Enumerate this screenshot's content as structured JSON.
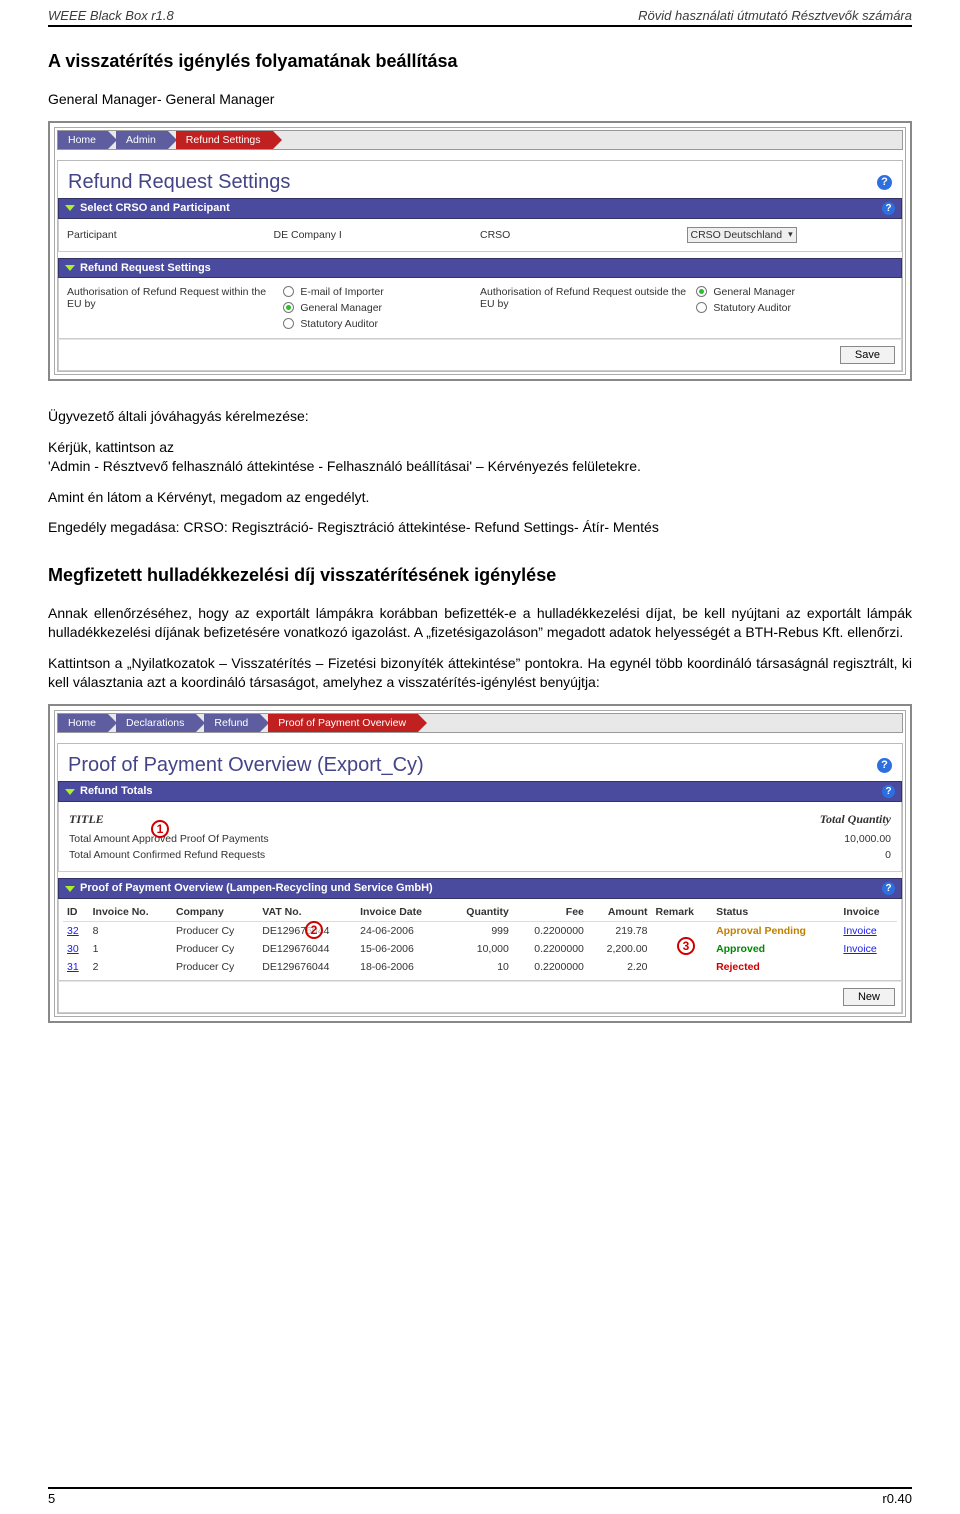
{
  "doc": {
    "header_left": "WEEE Black Box r1.8",
    "header_right": "Rövid használati útmutató Résztvevők számára",
    "footer_left": "5",
    "footer_right": "r0.40"
  },
  "section1": {
    "title": "A visszatérítés igénylés folyamatának beállítása",
    "subtitle": "General Manager- General Manager"
  },
  "shot1": {
    "crumbs": [
      "Home",
      "Admin",
      "Refund Settings"
    ],
    "panel_title": "Refund Request Settings",
    "help": "?",
    "sec1_title": "Select CRSO and Participant",
    "participant_label": "Participant",
    "participant_value": "DE Company I",
    "crso_label": "CRSO",
    "crso_value": "CRSO Deutschland",
    "sec2_title": "Refund Request Settings",
    "col1_label": "Authorisation of Refund Request within the EU by",
    "col1_options": [
      "E-mail of Importer",
      "General Manager",
      "Statutory Auditor"
    ],
    "col1_selected_index": 1,
    "col2_label": "Authorisation of Refund Request outside the EU by",
    "col2_options": [
      "General Manager",
      "Statutory Auditor"
    ],
    "col2_selected_index": 0,
    "save_btn": "Save"
  },
  "paras1": [
    "Ügyvezető általi jóváhagyás kérelmezése:",
    "Kérjük, kattintson az",
    "'Admin - Résztvevő felhasználó áttekintése - Felhasználó beállításai' – Kérvényezés felületekre.",
    "Amint én látom a Kérvényt, megadom az engedélyt.",
    "Engedély megadása: CRSO: Regisztráció- Regisztráció áttekintése- Refund Settings- Átír- Mentés"
  ],
  "section2": {
    "title": "Megfizetett hulladékkezelési díj visszatérítésének igénylése",
    "p1": "Annak ellenőrzéséhez, hogy az exportált lámpákra korábban befizették-e a hulladékkezelési díjat, be kell nyújtani az exportált lámpák hulladékkezelési díjának befizetésére vonatkozó igazolást. A „fizetésigazoláson” megadott adatok helyességét a BTH-Rebus Kft. ellenőrzi.",
    "p2": "Kattintson a „Nyilatkozatok – Visszatérítés – Fizetési bizonyíték áttekintése” pontokra. Ha egynél több koordináló társaságnál regisztrált, ki kell választania azt a koordináló társaságot, amelyhez a visszatérítés-igénylést benyújtja:"
  },
  "shot2": {
    "crumbs": [
      "Home",
      "Declarations",
      "Refund",
      "Proof of Payment Overview"
    ],
    "panel_title": "Proof of Payment Overview (Export_Cy)",
    "help": "?",
    "sec1_title": "Refund Totals",
    "rt_title": "TITLE",
    "rt_qty_title": "Total Quantity",
    "rt_rows": [
      {
        "label": "Total Amount Approved Proof Of Payments",
        "qty": "10,000.00"
      },
      {
        "label": "Total Amount Confirmed Refund Requests",
        "qty": "0"
      }
    ],
    "sec2_title": "Proof of Payment Overview (Lampen-Recycling und Service GmbH)",
    "cols": [
      "ID",
      "Invoice No.",
      "Company",
      "VAT No.",
      "Invoice Date",
      "Quantity",
      "Fee",
      "Amount",
      "Remark",
      "Status",
      "Invoice"
    ],
    "rows": [
      {
        "id": "32",
        "inv": "8",
        "company": "Producer Cy",
        "vat": "DE129676044",
        "date": "24-06-2006",
        "qty": "999",
        "fee": "0.2200000",
        "amount": "219.78",
        "remark": "",
        "status": "Approval Pending",
        "status_class": "status-pending",
        "invoice": "Invoice"
      },
      {
        "id": "30",
        "inv": "1",
        "company": "Producer Cy",
        "vat": "DE129676044",
        "date": "15-06-2006",
        "qty": "10,000",
        "fee": "0.2200000",
        "amount": "2,200.00",
        "remark": "",
        "status": "Approved",
        "status_class": "status-approved",
        "invoice": "Invoice"
      },
      {
        "id": "31",
        "inv": "2",
        "company": "Producer Cy",
        "vat": "DE129676044",
        "date": "18-06-2006",
        "qty": "10",
        "fee": "0.2200000",
        "amount": "2.20",
        "remark": "",
        "status": "Rejected",
        "status_class": "status-rejected",
        "invoice": ""
      }
    ],
    "new_btn": "New"
  },
  "annotations": {
    "a1": "1",
    "a2": "2",
    "a3": "3"
  }
}
